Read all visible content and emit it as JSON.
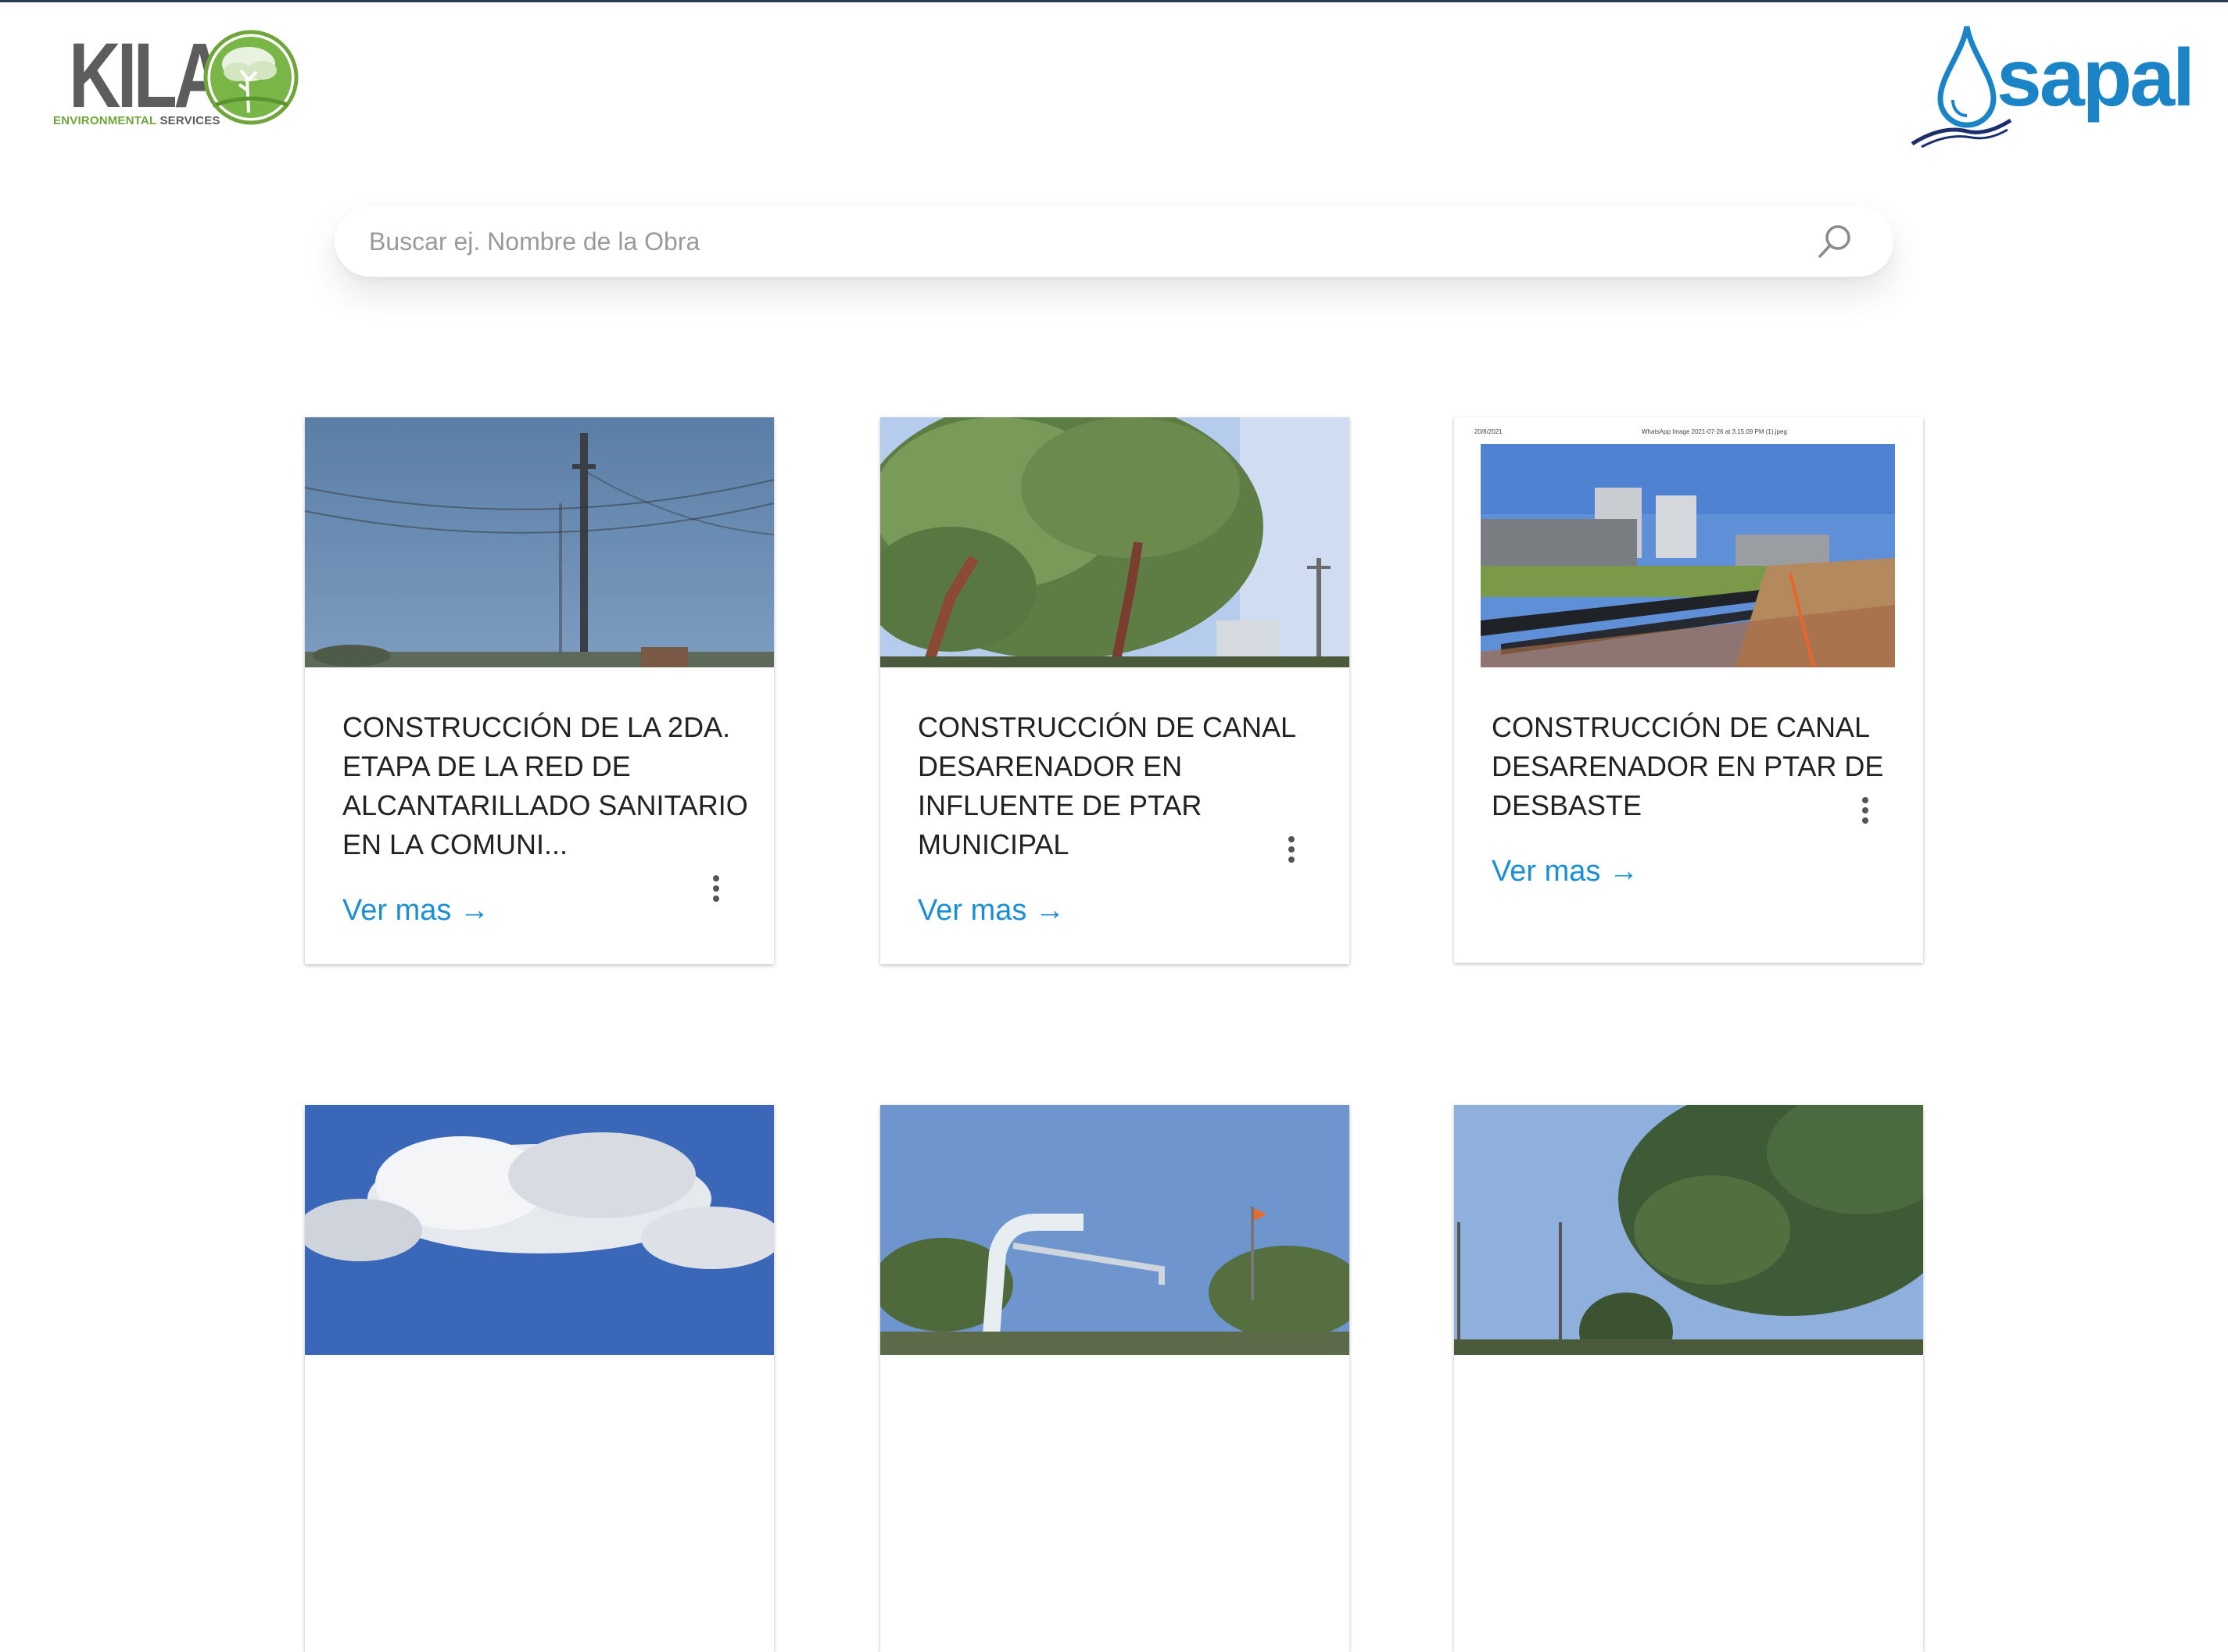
{
  "header": {
    "kila_logo": {
      "name": "KILA",
      "subtitle_green": "ENVIRONMENTAL",
      "subtitle_gray": "SERVICES"
    },
    "sapal_logo": {
      "name": "sapal"
    }
  },
  "search": {
    "placeholder": "Buscar ej. Nombre de la Obra",
    "value": ""
  },
  "cards": [
    {
      "title": "CONSTRUCCIÓN DE LA 2DA. ETAPA DE LA RED DE ALCANTARILLADO SANITARIO EN LA COMUNI...",
      "link": "Ver mas →",
      "image": "power-line-sky"
    },
    {
      "title": "CONSTRUCCIÓN DE CANAL DESARENADOR EN INFLUENTE DE PTAR MUNICIPAL",
      "link": "Ver mas →",
      "image": "tree-power-pole"
    },
    {
      "title": "CONSTRUCCIÓN DE CANAL DESARENADOR EN PTAR DE DESBASTE",
      "link": "Ver mas →",
      "image": "treatment-plant-pipes",
      "image_caption_date": "20/8/2021",
      "image_caption_file": "WhatsApp Image 2021-07-26 at 3.15.09 PM (1).jpeg"
    },
    {
      "title": "",
      "link": "",
      "image": "clouds-sky"
    },
    {
      "title": "",
      "link": "",
      "image": "pipe-structure"
    },
    {
      "title": "",
      "link": "",
      "image": "pine-tree"
    }
  ],
  "colors": {
    "accent": "#1a8fd6",
    "kila_green": "#6fa539",
    "sapal_blue": "#1a84c7",
    "title_text": "#222222"
  },
  "icons": {
    "search": "search-icon",
    "menu": "more-vertical-icon"
  }
}
